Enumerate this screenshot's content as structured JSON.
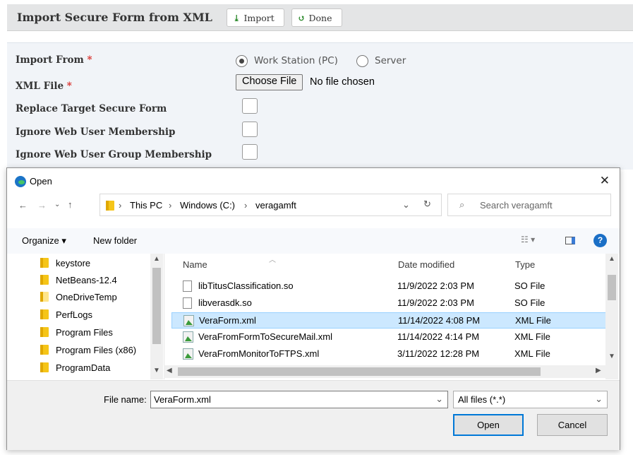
{
  "header": {
    "title": "Import Secure Form from XML",
    "import_label": "Import",
    "done_label": "Done"
  },
  "form": {
    "import_from_label": "Import From",
    "xml_file_label": "XML File",
    "replace_label": "Replace Target Secure Form",
    "ignore_user_label": "Ignore Web User Membership",
    "ignore_group_label": "Ignore Web User Group Membership",
    "required_mark": "*",
    "radio_pc": "Work Station (PC)",
    "radio_server": "Server",
    "selected_source": "Work Station (PC)",
    "choose_file": "Choose File",
    "no_file": "No file chosen"
  },
  "dialog": {
    "title": "Open",
    "breadcrumb": [
      "This PC",
      "Windows (C:)",
      "veragamft"
    ],
    "search_placeholder": "Search veragamft",
    "organize": "Organize ▾",
    "new_folder": "New folder",
    "nav_items": [
      "keystore",
      "NetBeans-12.4",
      "OneDriveTemp",
      "PerfLogs",
      "Program Files",
      "Program Files (x86)",
      "ProgramData"
    ],
    "columns": [
      "Name",
      "Date modified",
      "Type"
    ],
    "files": [
      {
        "name": "libTitusClassification.so",
        "date": "11/9/2022 2:03 PM",
        "type": "SO File"
      },
      {
        "name": "libverasdk.so",
        "date": "11/9/2022 2:03 PM",
        "type": "SO File"
      },
      {
        "name": "VeraForm.xml",
        "date": "11/14/2022 4:08 PM",
        "type": "XML File"
      },
      {
        "name": "VeraFromFormToSecureMail.xml",
        "date": "11/14/2022 4:14 PM",
        "type": "XML File"
      },
      {
        "name": "VeraFromMonitorToFTPS.xml",
        "date": "3/11/2022 12:28 PM",
        "type": "XML File"
      }
    ],
    "selected_file": "VeraForm.xml",
    "file_name_label": "File name:",
    "file_name_value": "VeraForm.xml",
    "file_type": "All files (*.*)",
    "open_label": "Open",
    "cancel_label": "Cancel"
  }
}
